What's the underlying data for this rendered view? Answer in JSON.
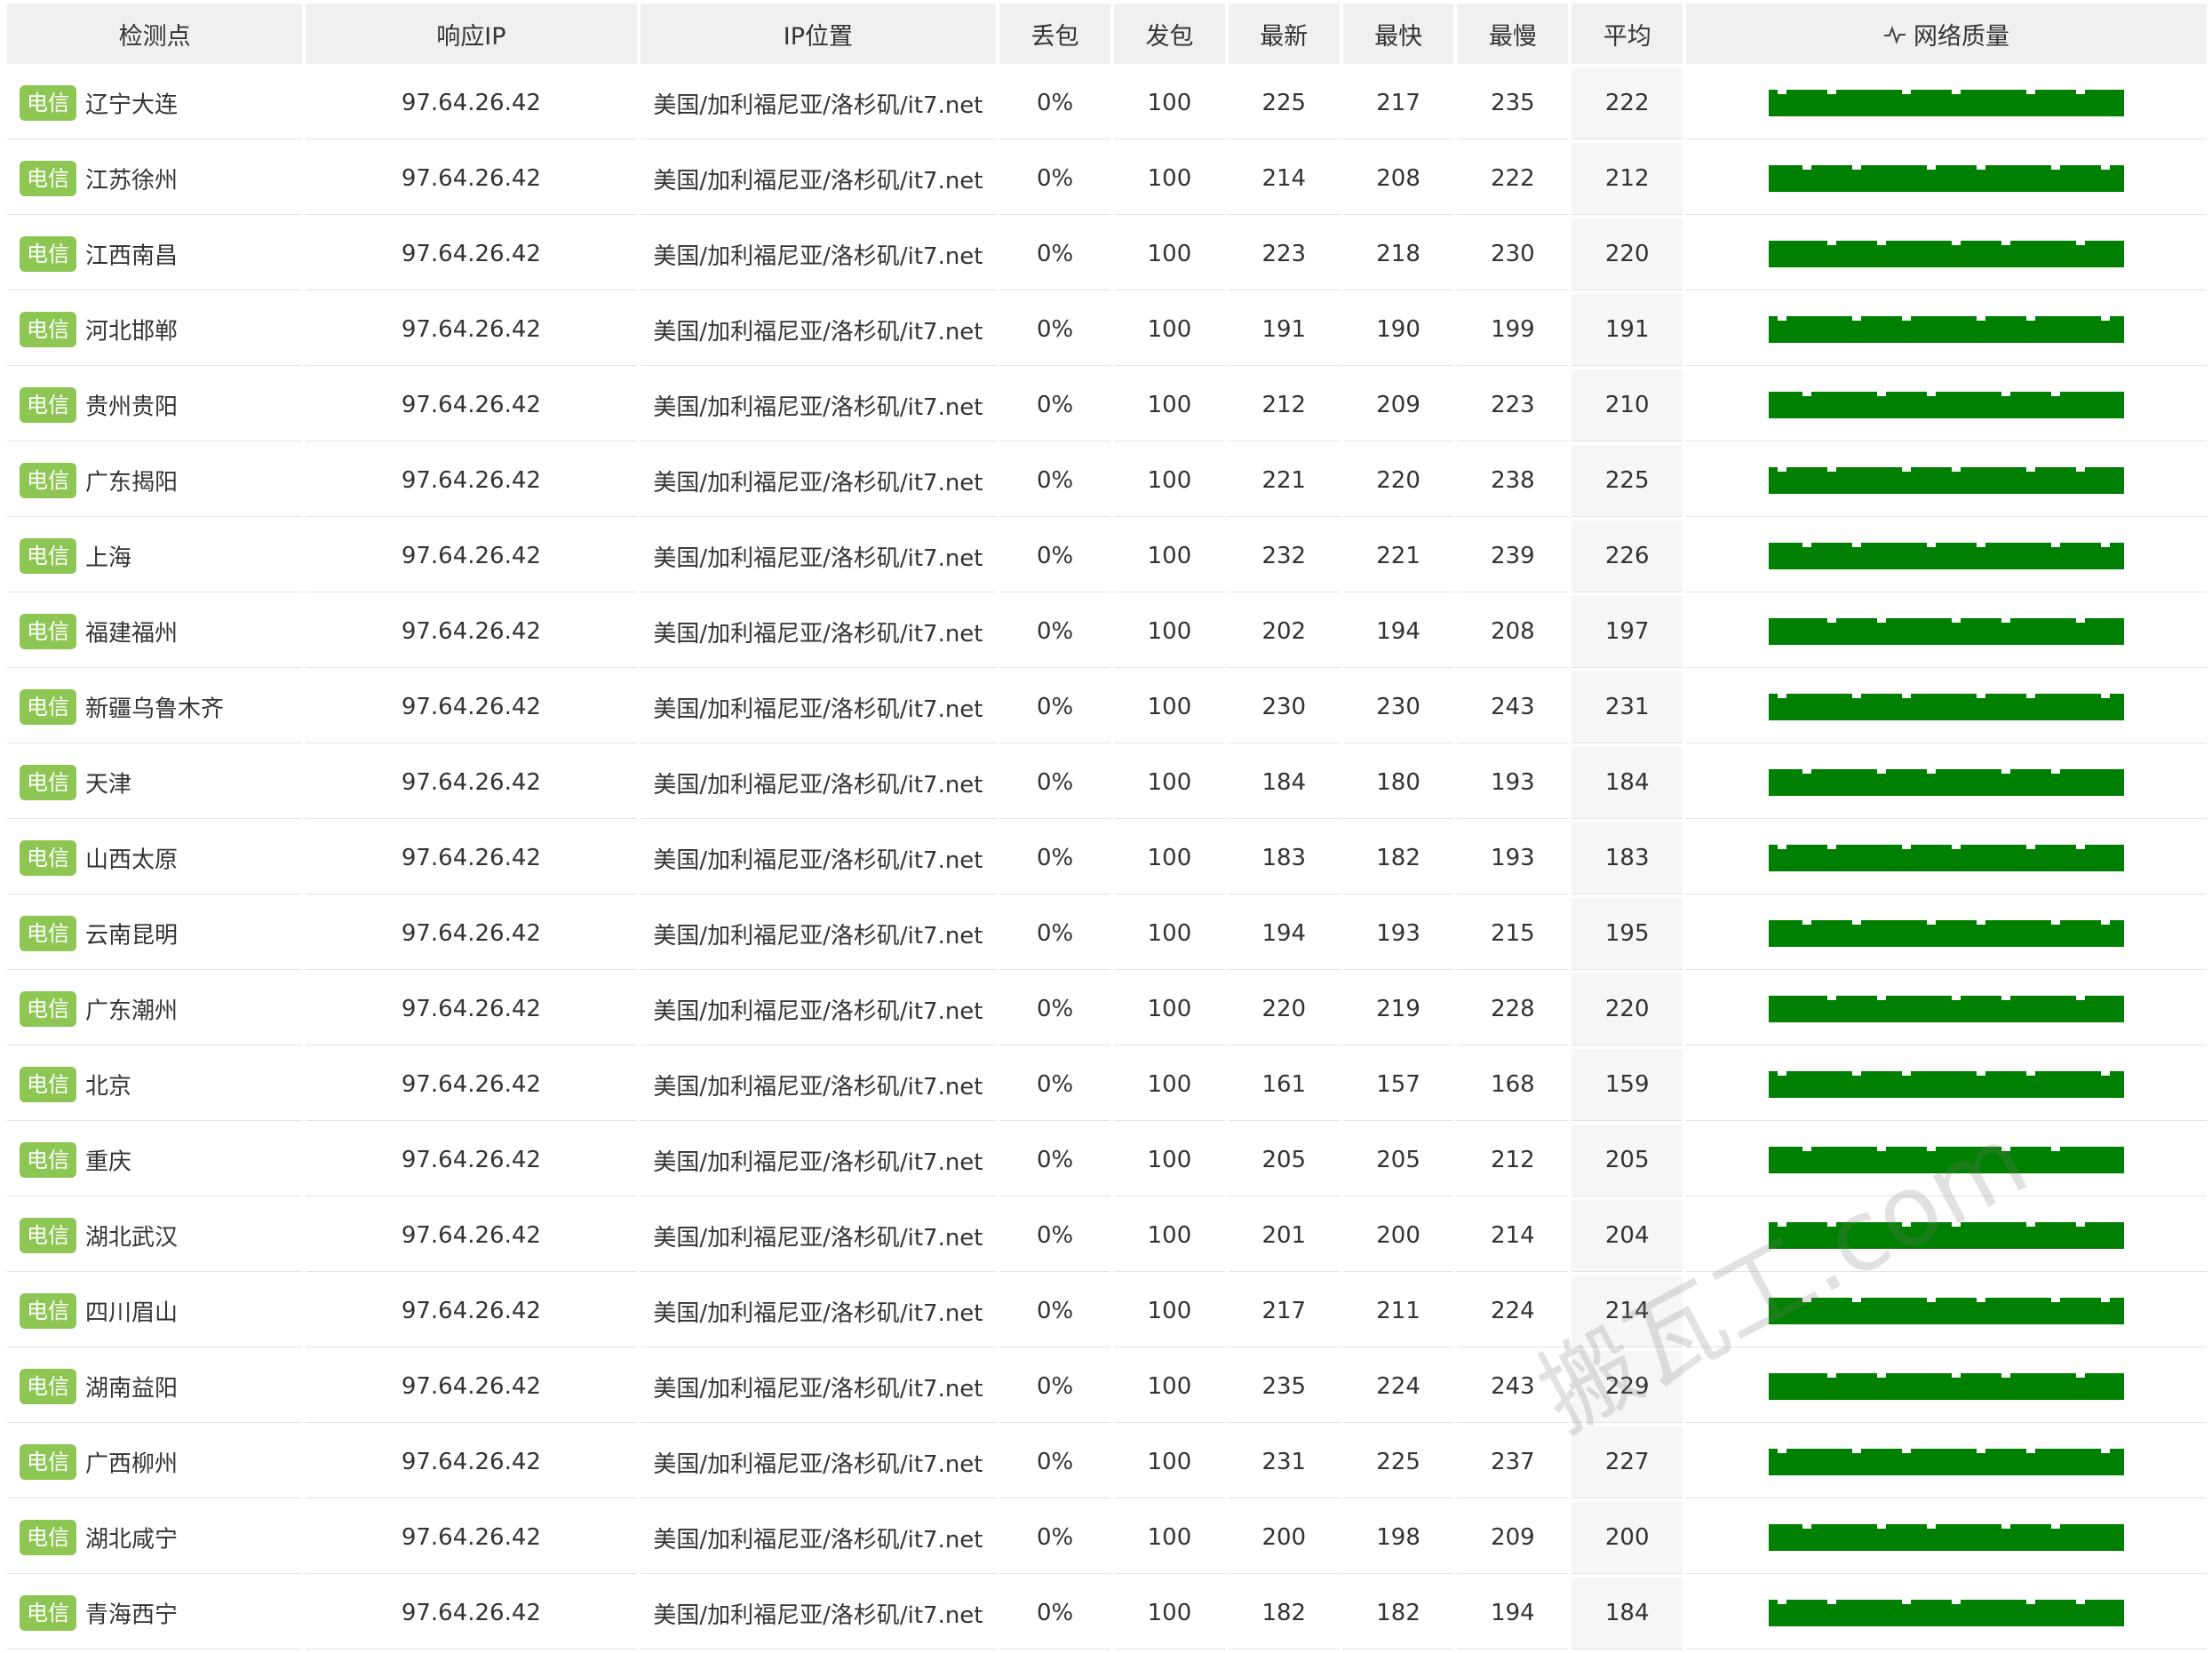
{
  "headers": {
    "location": "检测点",
    "ip": "响应IP",
    "ip_location": "IP位置",
    "loss": "丢包",
    "sent": "发包",
    "latest": "最新",
    "fastest": "最快",
    "slowest": "最慢",
    "average": "平均",
    "quality": "网络质量",
    "quality_icon": "activity-icon"
  },
  "colors": {
    "badge": "#8dc653",
    "quality_bar": "#008000",
    "header_bg": "#f0f0f0"
  },
  "rows": [
    {
      "isp": "电信",
      "location": "辽宁大连",
      "ip": "97.64.26.42",
      "ip_location": "美国/加利福尼亚/洛杉矶/it7.net",
      "loss": "0%",
      "sent": "100",
      "latest": "225",
      "fastest": "217",
      "slowest": "235",
      "avg": "222"
    },
    {
      "isp": "电信",
      "location": "江苏徐州",
      "ip": "97.64.26.42",
      "ip_location": "美国/加利福尼亚/洛杉矶/it7.net",
      "loss": "0%",
      "sent": "100",
      "latest": "214",
      "fastest": "208",
      "slowest": "222",
      "avg": "212"
    },
    {
      "isp": "电信",
      "location": "江西南昌",
      "ip": "97.64.26.42",
      "ip_location": "美国/加利福尼亚/洛杉矶/it7.net",
      "loss": "0%",
      "sent": "100",
      "latest": "223",
      "fastest": "218",
      "slowest": "230",
      "avg": "220"
    },
    {
      "isp": "电信",
      "location": "河北邯郸",
      "ip": "97.64.26.42",
      "ip_location": "美国/加利福尼亚/洛杉矶/it7.net",
      "loss": "0%",
      "sent": "100",
      "latest": "191",
      "fastest": "190",
      "slowest": "199",
      "avg": "191"
    },
    {
      "isp": "电信",
      "location": "贵州贵阳",
      "ip": "97.64.26.42",
      "ip_location": "美国/加利福尼亚/洛杉矶/it7.net",
      "loss": "0%",
      "sent": "100",
      "latest": "212",
      "fastest": "209",
      "slowest": "223",
      "avg": "210"
    },
    {
      "isp": "电信",
      "location": "广东揭阳",
      "ip": "97.64.26.42",
      "ip_location": "美国/加利福尼亚/洛杉矶/it7.net",
      "loss": "0%",
      "sent": "100",
      "latest": "221",
      "fastest": "220",
      "slowest": "238",
      "avg": "225"
    },
    {
      "isp": "电信",
      "location": "上海",
      "ip": "97.64.26.42",
      "ip_location": "美国/加利福尼亚/洛杉矶/it7.net",
      "loss": "0%",
      "sent": "100",
      "latest": "232",
      "fastest": "221",
      "slowest": "239",
      "avg": "226"
    },
    {
      "isp": "电信",
      "location": "福建福州",
      "ip": "97.64.26.42",
      "ip_location": "美国/加利福尼亚/洛杉矶/it7.net",
      "loss": "0%",
      "sent": "100",
      "latest": "202",
      "fastest": "194",
      "slowest": "208",
      "avg": "197"
    },
    {
      "isp": "电信",
      "location": "新疆乌鲁木齐",
      "ip": "97.64.26.42",
      "ip_location": "美国/加利福尼亚/洛杉矶/it7.net",
      "loss": "0%",
      "sent": "100",
      "latest": "230",
      "fastest": "230",
      "slowest": "243",
      "avg": "231"
    },
    {
      "isp": "电信",
      "location": "天津",
      "ip": "97.64.26.42",
      "ip_location": "美国/加利福尼亚/洛杉矶/it7.net",
      "loss": "0%",
      "sent": "100",
      "latest": "184",
      "fastest": "180",
      "slowest": "193",
      "avg": "184"
    },
    {
      "isp": "电信",
      "location": "山西太原",
      "ip": "97.64.26.42",
      "ip_location": "美国/加利福尼亚/洛杉矶/it7.net",
      "loss": "0%",
      "sent": "100",
      "latest": "183",
      "fastest": "182",
      "slowest": "193",
      "avg": "183"
    },
    {
      "isp": "电信",
      "location": "云南昆明",
      "ip": "97.64.26.42",
      "ip_location": "美国/加利福尼亚/洛杉矶/it7.net",
      "loss": "0%",
      "sent": "100",
      "latest": "194",
      "fastest": "193",
      "slowest": "215",
      "avg": "195"
    },
    {
      "isp": "电信",
      "location": "广东潮州",
      "ip": "97.64.26.42",
      "ip_location": "美国/加利福尼亚/洛杉矶/it7.net",
      "loss": "0%",
      "sent": "100",
      "latest": "220",
      "fastest": "219",
      "slowest": "228",
      "avg": "220"
    },
    {
      "isp": "电信",
      "location": "北京",
      "ip": "97.64.26.42",
      "ip_location": "美国/加利福尼亚/洛杉矶/it7.net",
      "loss": "0%",
      "sent": "100",
      "latest": "161",
      "fastest": "157",
      "slowest": "168",
      "avg": "159"
    },
    {
      "isp": "电信",
      "location": "重庆",
      "ip": "97.64.26.42",
      "ip_location": "美国/加利福尼亚/洛杉矶/it7.net",
      "loss": "0%",
      "sent": "100",
      "latest": "205",
      "fastest": "205",
      "slowest": "212",
      "avg": "205"
    },
    {
      "isp": "电信",
      "location": "湖北武汉",
      "ip": "97.64.26.42",
      "ip_location": "美国/加利福尼亚/洛杉矶/it7.net",
      "loss": "0%",
      "sent": "100",
      "latest": "201",
      "fastest": "200",
      "slowest": "214",
      "avg": "204"
    },
    {
      "isp": "电信",
      "location": "四川眉山",
      "ip": "97.64.26.42",
      "ip_location": "美国/加利福尼亚/洛杉矶/it7.net",
      "loss": "0%",
      "sent": "100",
      "latest": "217",
      "fastest": "211",
      "slowest": "224",
      "avg": "214"
    },
    {
      "isp": "电信",
      "location": "湖南益阳",
      "ip": "97.64.26.42",
      "ip_location": "美国/加利福尼亚/洛杉矶/it7.net",
      "loss": "0%",
      "sent": "100",
      "latest": "235",
      "fastest": "224",
      "slowest": "243",
      "avg": "229"
    },
    {
      "isp": "电信",
      "location": "广西柳州",
      "ip": "97.64.26.42",
      "ip_location": "美国/加利福尼亚/洛杉矶/it7.net",
      "loss": "0%",
      "sent": "100",
      "latest": "231",
      "fastest": "225",
      "slowest": "237",
      "avg": "227"
    },
    {
      "isp": "电信",
      "location": "湖北咸宁",
      "ip": "97.64.26.42",
      "ip_location": "美国/加利福尼亚/洛杉矶/it7.net",
      "loss": "0%",
      "sent": "100",
      "latest": "200",
      "fastest": "198",
      "slowest": "209",
      "avg": "200"
    },
    {
      "isp": "电信",
      "location": "青海西宁",
      "ip": "97.64.26.42",
      "ip_location": "美国/加利福尼亚/洛杉矶/it7.net",
      "loss": "0%",
      "sent": "100",
      "latest": "182",
      "fastest": "182",
      "slowest": "194",
      "avg": "184"
    }
  ],
  "watermark": "搬瓦工.com"
}
